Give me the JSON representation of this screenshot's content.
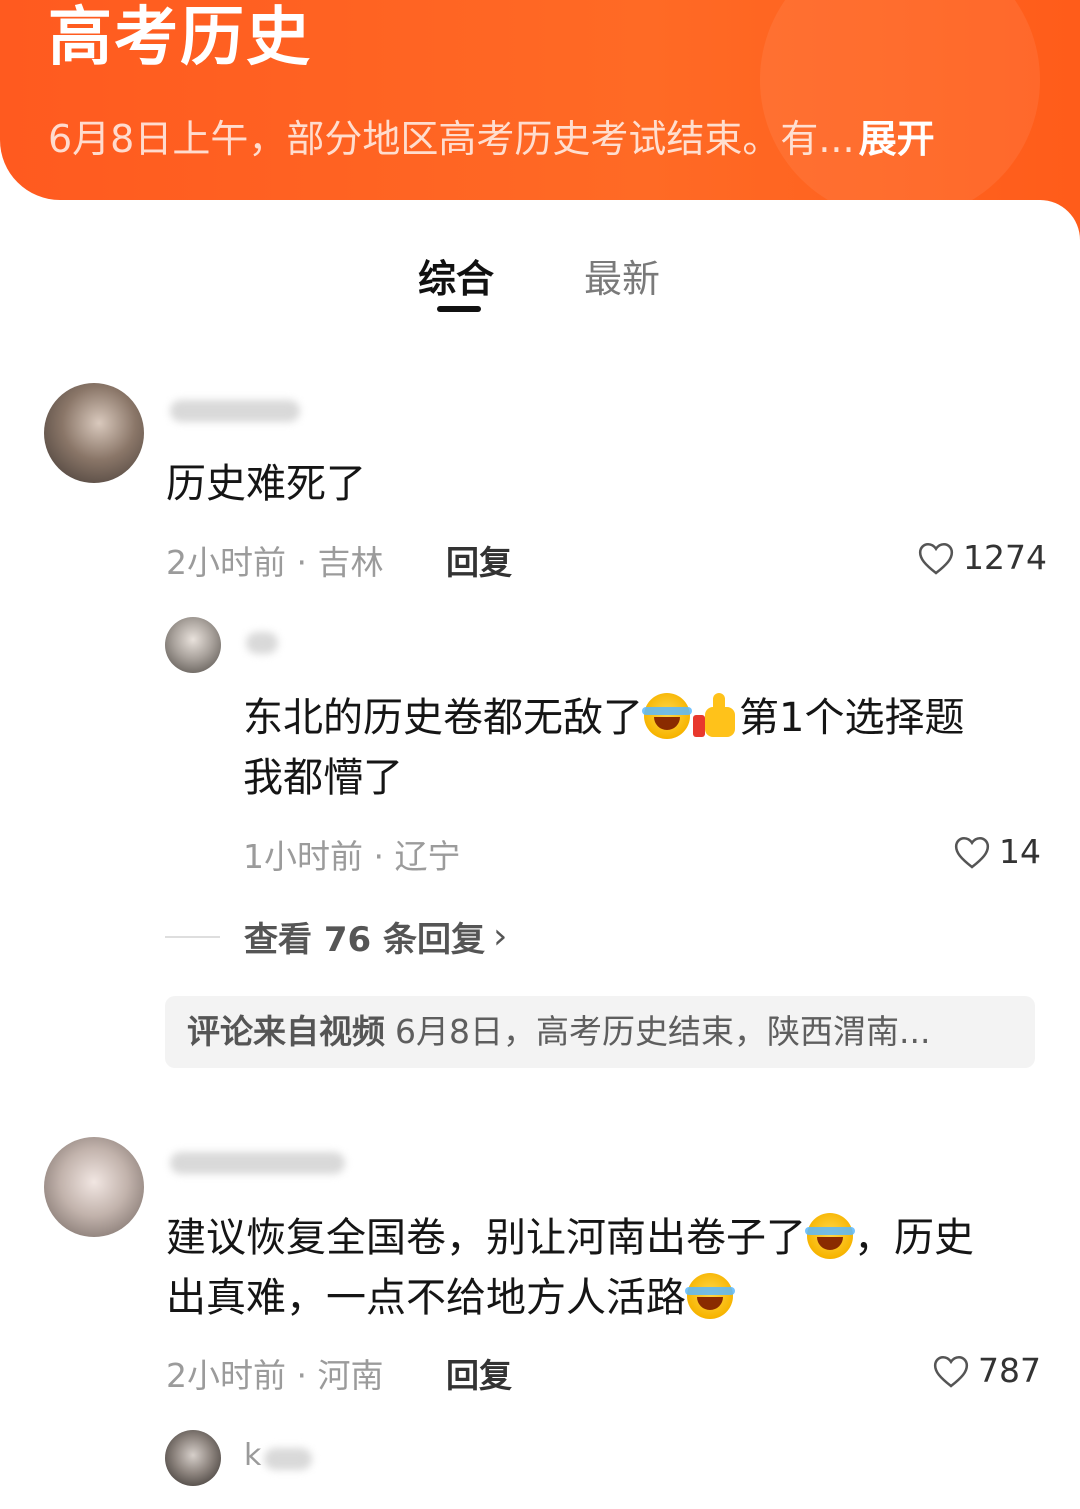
{
  "topic": {
    "title": "高考历史",
    "description": "6月8日上午，部分地区高考历史考试结束。有...",
    "expand_label": "展开"
  },
  "tabs": [
    {
      "label": "综合",
      "active": true
    },
    {
      "label": "最新",
      "active": false
    }
  ],
  "comments": [
    {
      "text": "历史难死了",
      "time": "2小时前",
      "location": "吉林",
      "reply_label": "回复",
      "likes": "1274",
      "reply": {
        "text_part1": "东北的历史卷都无敌了",
        "text_part2": "第1个选择题",
        "text_part3": "我都懵了",
        "time": "1小时前",
        "location": "辽宁",
        "likes": "14"
      },
      "view_replies_label": "查看 76 条回复",
      "source_lead": "评论来自视频",
      "source_text": "6月8日，高考历史结束，陕西渭南..."
    },
    {
      "text_part1": "建议恢复全国卷，别让河南出卷子了",
      "text_part2": "，历史",
      "text_part3": "出真难，一点不给地方人活路",
      "time": "2小时前",
      "location": "河南",
      "reply_label": "回复",
      "likes": "787",
      "reply": {
        "username_visible": "k"
      }
    }
  ],
  "colors": {
    "header_orange": "#ff5a1f",
    "text_primary": "#151515",
    "text_meta": "#9b9b9b"
  },
  "icons": [
    "heart-icon",
    "chevron-right-icon",
    "grinning-squinting-face-emoji",
    "thumbs-up-emoji"
  ]
}
